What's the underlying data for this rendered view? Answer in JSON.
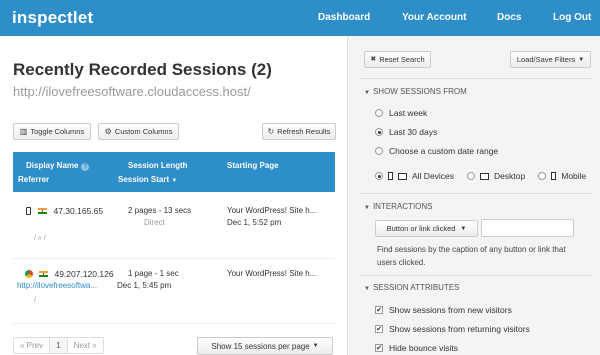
{
  "app": {
    "logo": "inspectlet",
    "nav": [
      "Dashboard",
      "Your Account",
      "Docs",
      "Log Out"
    ]
  },
  "main": {
    "title": "Recently Recorded Sessions (2)",
    "url": "http://ilovefreesoftware.cloudaccess.host/",
    "toolbar": {
      "toggle_columns": "Toggle Columns",
      "custom_columns": "Custom Columns",
      "refresh": "Refresh Results"
    },
    "table": {
      "headers": {
        "display_name": "Display Name",
        "referrer": "Referrer",
        "session_length": "Session Length",
        "session_start": "Session Start",
        "session_start_sort": "▼",
        "starting_page": "Starting Page"
      },
      "rows": [
        {
          "device": "mobile",
          "ip": "47.30.165.65",
          "length": "2 pages - 13 secs",
          "referrer_note": "Direct",
          "page": "Your WordPress! Site h...",
          "start": "Dec 1, 5:52 pm",
          "referrer": "",
          "path": "/ » /"
        },
        {
          "device": "desktop",
          "ip": "49.207.120.126",
          "length": "1 page - 1 sec",
          "referrer_note": "",
          "page": "Your WordPress! Site h...",
          "start": "Dec 1, 5:45 pm",
          "referrer": "http://ilovefreesoftwa...",
          "path": "/"
        }
      ]
    },
    "pager": {
      "prev": "« Prev",
      "page": "1",
      "next": "Next »",
      "per_page": "Show 15 sessions per page"
    }
  },
  "filters": {
    "reset": "Reset Search",
    "load_save": "Load/Save Filters",
    "sessions_from": {
      "heading": "SHOW SESSIONS FROM",
      "options": [
        "Last week",
        "Last 30 days",
        "Choose a custom date range"
      ],
      "selected": 1
    },
    "devices": {
      "options": [
        "All Devices",
        "Desktop",
        "Mobile"
      ],
      "selected": 0
    },
    "interactions": {
      "heading": "INTERACTIONS",
      "select_value": "Button or link clicked",
      "hint": "Find sessions by the caption of any button or link that users clicked."
    },
    "attributes": {
      "heading": "SESSION ATTRIBUTES",
      "options": [
        "Show sessions from new visitors",
        "Show sessions from returning visitors",
        "Hide bounce visits"
      ],
      "checked": [
        true,
        true,
        true
      ]
    }
  },
  "colors": {
    "brand": "#2d8ec9",
    "panel": "#f4f4f4"
  }
}
